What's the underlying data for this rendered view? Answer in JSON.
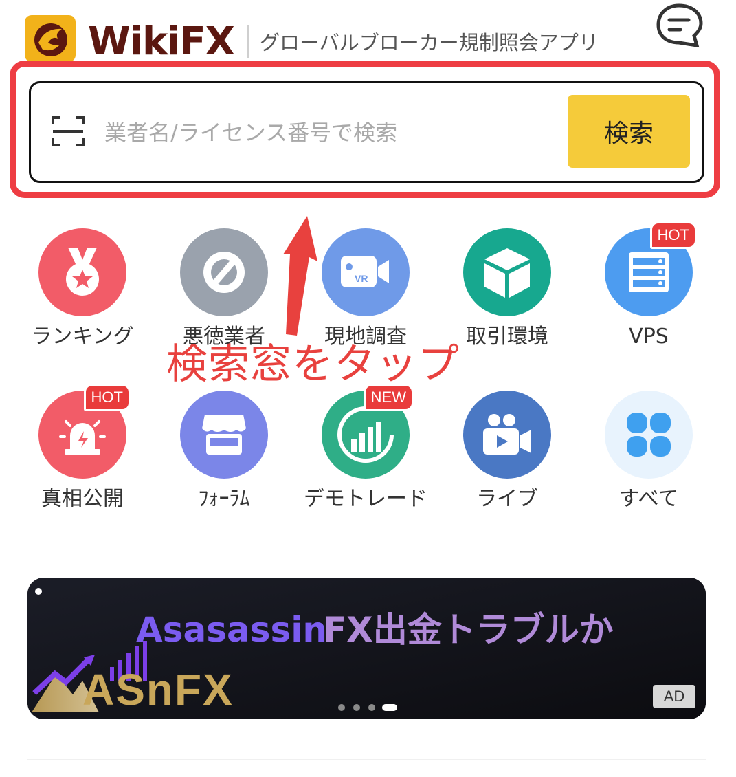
{
  "header": {
    "logo_text": "WikiFX",
    "tagline": "グローバルブローカー規制照会アプリ"
  },
  "search": {
    "placeholder": "業者名/ライセンス番号で検索",
    "value": "",
    "button_label": "検索"
  },
  "annotation": {
    "text": "検索窓をタップ",
    "color": "#e8413e"
  },
  "grid": [
    {
      "label": "ランキング",
      "icon": "medal-icon",
      "color": "#f25c68",
      "badge": ""
    },
    {
      "label": "悪徳業者",
      "icon": "ban-icon",
      "color": "#9aa2ad",
      "badge": ""
    },
    {
      "label": "現地調査",
      "icon": "vr-camera-icon",
      "color": "#6f9ae8",
      "badge": ""
    },
    {
      "label": "取引環境",
      "icon": "cube-icon",
      "color": "#17a88f",
      "badge": ""
    },
    {
      "label": "VPS",
      "icon": "server-icon",
      "color": "#4d9cf0",
      "badge": "HOT"
    },
    {
      "label": "真相公開",
      "icon": "alarm-icon",
      "color": "#f25c68",
      "badge": "HOT"
    },
    {
      "label": "ﾌｫｰﾗﾑ",
      "icon": "store-icon",
      "color": "#7b86e8",
      "badge": ""
    },
    {
      "label": "デモトレード",
      "icon": "bar-chart-icon",
      "color": "#2fae87",
      "badge": "NEW"
    },
    {
      "label": "ライブ",
      "icon": "video-camera-icon",
      "color": "#4a78c4",
      "badge": ""
    },
    {
      "label": "すべて",
      "icon": "clover-grid-icon",
      "color": "#e8f3fd",
      "badge": ""
    }
  ],
  "banner": {
    "brand": "Asasassin",
    "title": "FX出金トラブルか",
    "logo_text": "ASnFX",
    "ad_label": "AD",
    "slide_count": 4,
    "active_slide": 4
  },
  "colors": {
    "highlight": "#ee3d43",
    "search_button": "#f5cb3a",
    "logo_brown": "#5b1710"
  }
}
